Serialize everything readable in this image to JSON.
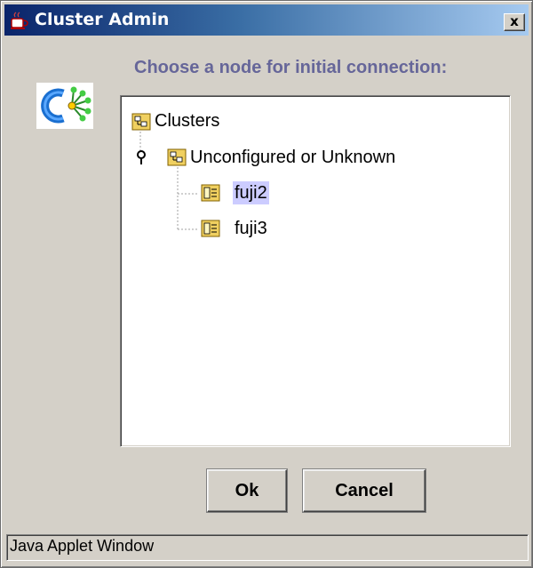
{
  "window": {
    "title": "Cluster Admin",
    "close_label": "x"
  },
  "prompt": "Choose a node for initial connection:",
  "tree": {
    "root": {
      "label": "Clusters",
      "icon": "cluster-folder-icon"
    },
    "group": {
      "label": "Unconfigured or Unknown",
      "icon": "cluster-folder-icon",
      "expanded": true
    },
    "nodes": [
      {
        "label": "fuji2",
        "icon": "server-node-icon",
        "selected": true
      },
      {
        "label": "fuji3",
        "icon": "server-node-icon",
        "selected": false
      }
    ]
  },
  "buttons": {
    "ok": "Ok",
    "cancel": "Cancel"
  },
  "status_bar": "Java Applet Window",
  "colors": {
    "title_gradient_start": "#0a246a",
    "title_gradient_end": "#a6caf0",
    "dialog_background": "#d4d0c8",
    "prompt_text": "#666699",
    "selection_background": "#ccccff"
  }
}
